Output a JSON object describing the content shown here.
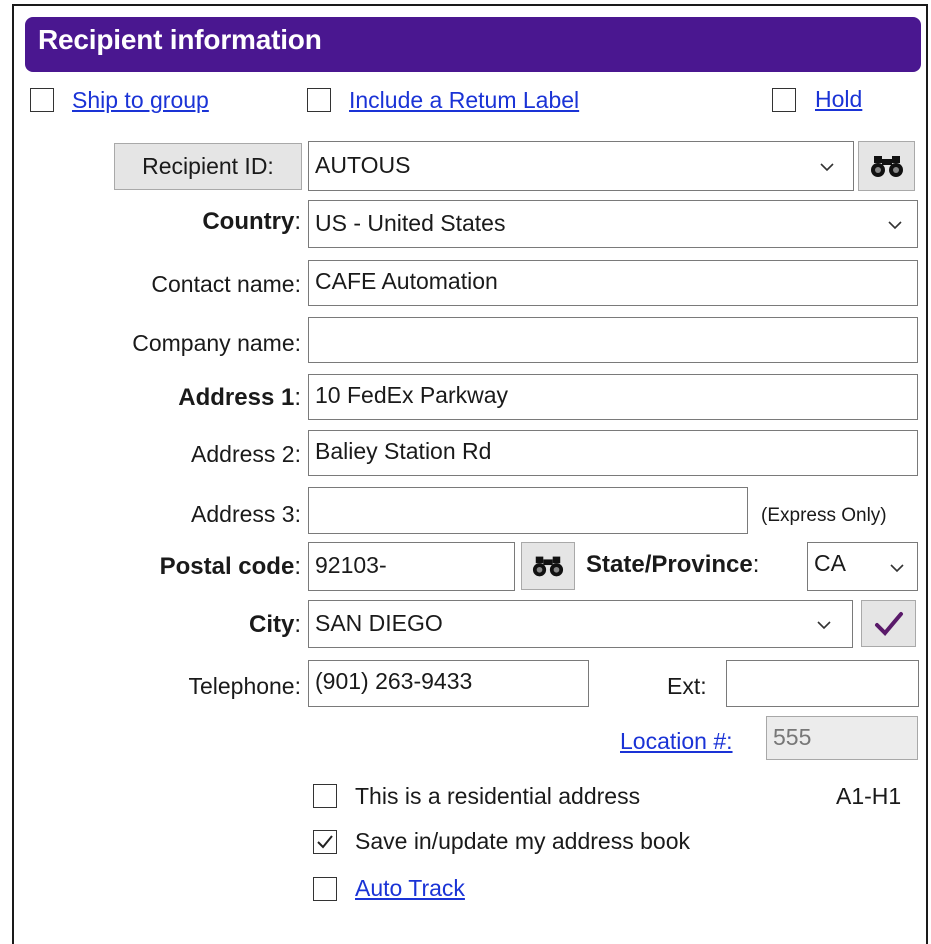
{
  "header": {
    "title": "Recipient information"
  },
  "options": {
    "ship_to_group": "Ship to group",
    "include_return_label": "Include a Retum Label",
    "hold": "Hold"
  },
  "recipient_id": {
    "button_label": "Recipient ID:",
    "value": "AUTOUS"
  },
  "country": {
    "label": "Country",
    "value": "US - United States"
  },
  "contact_name": {
    "label": "Contact name:",
    "value": "CAFE Automation"
  },
  "company_name": {
    "label": "Company name:",
    "value": ""
  },
  "address1": {
    "label": "Address 1",
    "value": "10 FedEx Parkway"
  },
  "address2": {
    "label": "Address 2:",
    "value": "Baliey Station Rd"
  },
  "address3": {
    "label": "Address 3:",
    "value": "",
    "note": "(Express Only)"
  },
  "postal_code": {
    "label": "Postal code",
    "value": "92103-"
  },
  "state": {
    "label": "State/Province",
    "value": "CA"
  },
  "city": {
    "label": "City",
    "value": "SAN DIEGO"
  },
  "telephone": {
    "label": "Telephone:",
    "value": "(901) 263-9433"
  },
  "ext": {
    "label": "Ext:",
    "value": ""
  },
  "location": {
    "label": "Location #:",
    "value": "555"
  },
  "residential": {
    "label": "This is a residential address",
    "checked": false
  },
  "route_code": "A1-H1",
  "save_address": {
    "label": "Save in/update my address book",
    "checked": true
  },
  "auto_track": {
    "label": "Auto Track",
    "checked": false
  },
  "colors": {
    "header": "#4a1790",
    "link": "#1a33d6",
    "checkmark": "#5a1a6a"
  }
}
